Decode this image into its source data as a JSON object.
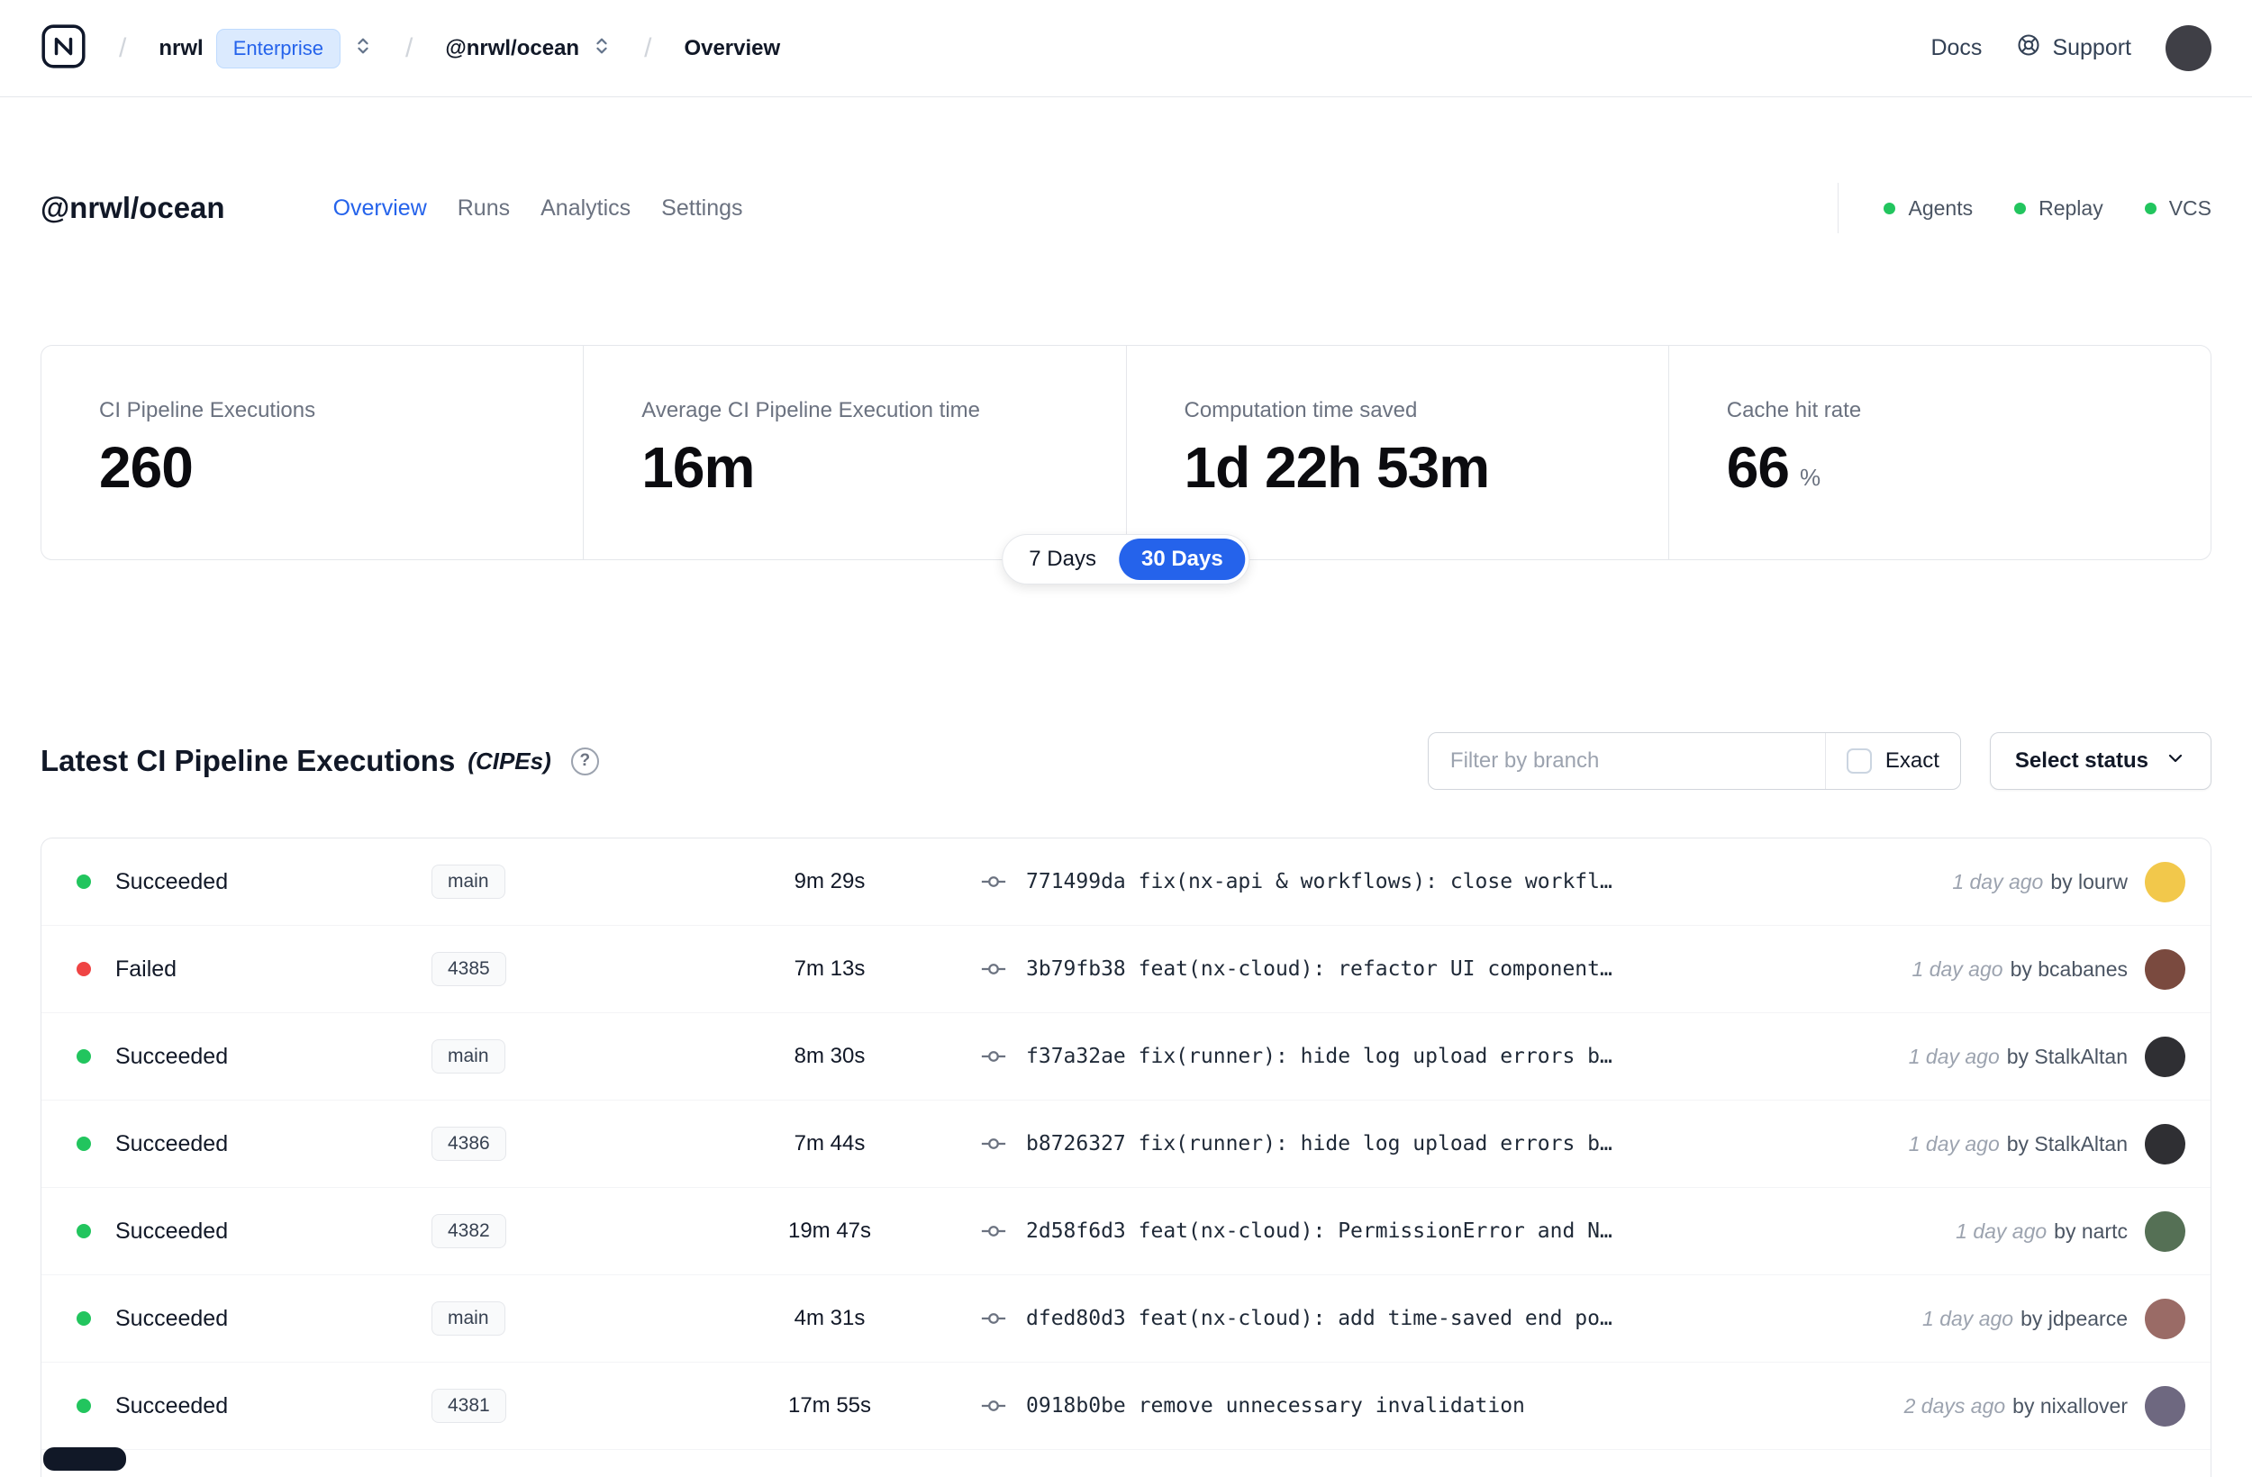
{
  "colors": {
    "accent": "#2563eb",
    "green": "#22c55e",
    "red": "#ef4444"
  },
  "icons": {
    "help": "?"
  },
  "navbar": {
    "org": "nrwl",
    "plan_badge": "Enterprise",
    "workspace": "@nrwl/ocean",
    "page": "Overview",
    "docs": "Docs",
    "support": "Support",
    "avatar_color": "#3f3f46"
  },
  "workspace_header": {
    "title": "@nrwl/ocean",
    "tabs": [
      {
        "label": "Overview",
        "active": true
      },
      {
        "label": "Runs",
        "active": false
      },
      {
        "label": "Analytics",
        "active": false
      },
      {
        "label": "Settings",
        "active": false
      }
    ],
    "indicators": [
      {
        "label": "Agents"
      },
      {
        "label": "Replay"
      },
      {
        "label": "VCS"
      }
    ]
  },
  "stats": {
    "cards": [
      {
        "label": "CI Pipeline Executions",
        "value": "260",
        "suffix": ""
      },
      {
        "label": "Average CI Pipeline Execution time",
        "value": "16m",
        "suffix": ""
      },
      {
        "label": "Computation time saved",
        "value": "1d 22h 53m",
        "suffix": ""
      },
      {
        "label": "Cache hit rate",
        "value": "66",
        "suffix": "%"
      }
    ],
    "range_toggle": [
      {
        "label": "7 Days",
        "active": false
      },
      {
        "label": "30 Days",
        "active": true
      }
    ]
  },
  "cipes": {
    "title": "Latest CI Pipeline Executions",
    "title_suffix": "(CIPEs)",
    "filter_placeholder": "Filter by branch",
    "exact_label": "Exact",
    "status_select_label": "Select status",
    "rows": [
      {
        "status": "Succeeded",
        "status_color": "green",
        "branch": "main",
        "duration": "9m 29s",
        "commit_hash": "771499da",
        "commit_message": "fix(nx-api & workflows): close workfl…",
        "time": "1 day ago",
        "author": "by lourw",
        "avatar_color": "#f2c84b"
      },
      {
        "status": "Failed",
        "status_color": "red",
        "branch": "4385",
        "duration": "7m 13s",
        "commit_hash": "3b79fb38",
        "commit_message": "feat(nx-cloud): refactor UI component…",
        "time": "1 day ago",
        "author": "by bcabanes",
        "avatar_color": "#7a4a3f"
      },
      {
        "status": "Succeeded",
        "status_color": "green",
        "branch": "main",
        "duration": "8m 30s",
        "commit_hash": "f37a32ae",
        "commit_message": "fix(runner): hide log upload errors b…",
        "time": "1 day ago",
        "author": "by StalkAltan",
        "avatar_color": "#2f2f33"
      },
      {
        "status": "Succeeded",
        "status_color": "green",
        "branch": "4386",
        "duration": "7m 44s",
        "commit_hash": "b8726327",
        "commit_message": "fix(runner): hide log upload errors b…",
        "time": "1 day ago",
        "author": "by StalkAltan",
        "avatar_color": "#2f2f33"
      },
      {
        "status": "Succeeded",
        "status_color": "green",
        "branch": "4382",
        "duration": "19m 47s",
        "commit_hash": "2d58f6d3",
        "commit_message": "feat(nx-cloud): PermissionError and N…",
        "time": "1 day ago",
        "author": "by nartc",
        "avatar_color": "#557055"
      },
      {
        "status": "Succeeded",
        "status_color": "green",
        "branch": "main",
        "duration": "4m 31s",
        "commit_hash": "dfed80d3",
        "commit_message": "feat(nx-cloud): add time-saved end po…",
        "time": "1 day ago",
        "author": "by jdpearce",
        "avatar_color": "#9a6b66"
      },
      {
        "status": "Succeeded",
        "status_color": "green",
        "branch": "4381",
        "duration": "17m 55s",
        "commit_hash": "0918b0be",
        "commit_message": "remove unnecessary invalidation",
        "time": "2 days ago",
        "author": "by nixallover",
        "avatar_color": "#6e6880"
      }
    ]
  }
}
